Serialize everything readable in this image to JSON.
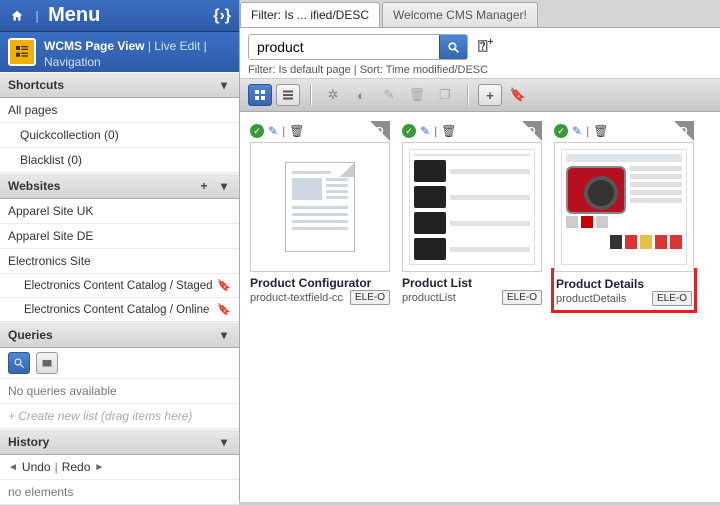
{
  "header": {
    "menu_label": "Menu"
  },
  "subheader": {
    "title": "WCMS Page View",
    "live_edit": "Live Edit",
    "navigation": "Navigation"
  },
  "sections": {
    "shortcuts": {
      "title": "Shortcuts",
      "all_pages": "All pages",
      "quickcollection": "Quickcollection (0)",
      "blacklist": "Blacklist (0)"
    },
    "websites": {
      "title": "Websites",
      "site1": "Apparel Site UK",
      "site2": "Apparel Site DE",
      "site3": "Electronics Site",
      "catalog1": "Electronics Content Catalog / Staged",
      "catalog2": "Electronics Content Catalog / Online"
    },
    "queries": {
      "title": "Queries",
      "empty": "No queries available",
      "hint": "+ Create new list (drag items here)"
    },
    "history": {
      "title": "History",
      "undo": "Undo",
      "redo": "Redo",
      "no_elements": "no elements"
    }
  },
  "tabs": {
    "tab1": "Filter: Is ... ified/DESC",
    "tab2": "Welcome CMS Manager!"
  },
  "search": {
    "value": "product",
    "filter_text": "Filter: Is default page | Sort: Time modified/DESC"
  },
  "cards": {
    "c1": {
      "title": "Product Configurator",
      "code": "product-textfield-cc",
      "badge": "ELE-O"
    },
    "c2": {
      "title": "Product List",
      "code": "productList",
      "badge": "ELE-O"
    },
    "c3": {
      "title": "Product Details",
      "code": "productDetails",
      "badge": "ELE-O"
    }
  }
}
